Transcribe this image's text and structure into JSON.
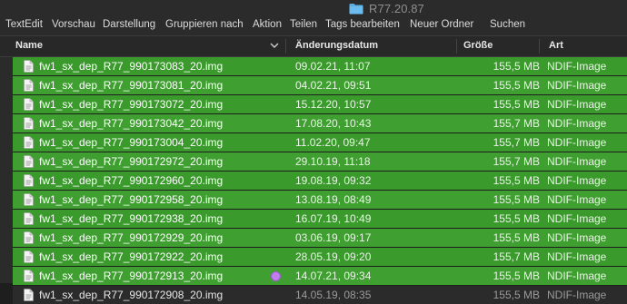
{
  "window": {
    "title": "R77.20.87",
    "folder_icon": "folder-icon"
  },
  "toolbar": [
    {
      "label": "TextEdit"
    },
    {
      "label": "Vorschau"
    },
    {
      "label": "Darstellung"
    },
    {
      "label": "Gruppieren nach"
    },
    {
      "label": "Aktion"
    },
    {
      "label": "Teilen"
    },
    {
      "label": "Tags bearbeiten"
    },
    {
      "label": "Neuer Ordner"
    },
    {
      "label": "Suchen"
    }
  ],
  "columns": {
    "name": "Name",
    "date": "Änderungsdatum",
    "size": "Größe",
    "kind": "Art",
    "sort_icon": "chevron-down-icon"
  },
  "colors": {
    "selection": "#3a9a2c",
    "tag_purple": "#c07ef0",
    "folder_blue": "#5aaee6"
  },
  "files": [
    {
      "name": "fw1_sx_dep_R77_990173083_20.img",
      "date": "09.02.21, 11:07",
      "size": "155,5 MB",
      "kind": "NDIF-Image",
      "selected": true
    },
    {
      "name": "fw1_sx_dep_R77_990173081_20.img",
      "date": "04.02.21, 09:51",
      "size": "155,5 MB",
      "kind": "NDIF-Image",
      "selected": true
    },
    {
      "name": "fw1_sx_dep_R77_990173072_20.img",
      "date": "15.12.20, 10:57",
      "size": "155,5 MB",
      "kind": "NDIF-Image",
      "selected": true
    },
    {
      "name": "fw1_sx_dep_R77_990173042_20.img",
      "date": "17.08.20, 10:43",
      "size": "155,7 MB",
      "kind": "NDIF-Image",
      "selected": true
    },
    {
      "name": "fw1_sx_dep_R77_990173004_20.img",
      "date": "11.02.20, 09:47",
      "size": "155,7 MB",
      "kind": "NDIF-Image",
      "selected": true
    },
    {
      "name": "fw1_sx_dep_R77_990172972_20.img",
      "date": "29.10.19, 11:18",
      "size": "155,7 MB",
      "kind": "NDIF-Image",
      "selected": true
    },
    {
      "name": "fw1_sx_dep_R77_990172960_20.img",
      "date": "19.08.19, 09:32",
      "size": "155,5 MB",
      "kind": "NDIF-Image",
      "selected": true
    },
    {
      "name": "fw1_sx_dep_R77_990172958_20.img",
      "date": "13.08.19, 08:49",
      "size": "155,5 MB",
      "kind": "NDIF-Image",
      "selected": true
    },
    {
      "name": "fw1_sx_dep_R77_990172938_20.img",
      "date": "16.07.19, 10:49",
      "size": "155,5 MB",
      "kind": "NDIF-Image",
      "selected": true
    },
    {
      "name": "fw1_sx_dep_R77_990172929_20.img",
      "date": "03.06.19, 09:17",
      "size": "155,5 MB",
      "kind": "NDIF-Image",
      "selected": true
    },
    {
      "name": "fw1_sx_dep_R77_990172922_20.img",
      "date": "28.05.19, 09:20",
      "size": "155,7 MB",
      "kind": "NDIF-Image",
      "selected": true
    },
    {
      "name": "fw1_sx_dep_R77_990172913_20.img",
      "date": "14.07.21, 09:34",
      "size": "155,5 MB",
      "kind": "NDIF-Image",
      "selected": true,
      "tag": "purple"
    },
    {
      "name": "fw1_sx_dep_R77_990172908_20.img",
      "date": "14.05.19, 08:35",
      "size": "155,5 MB",
      "kind": "NDIF-Image",
      "selected": false
    }
  ]
}
